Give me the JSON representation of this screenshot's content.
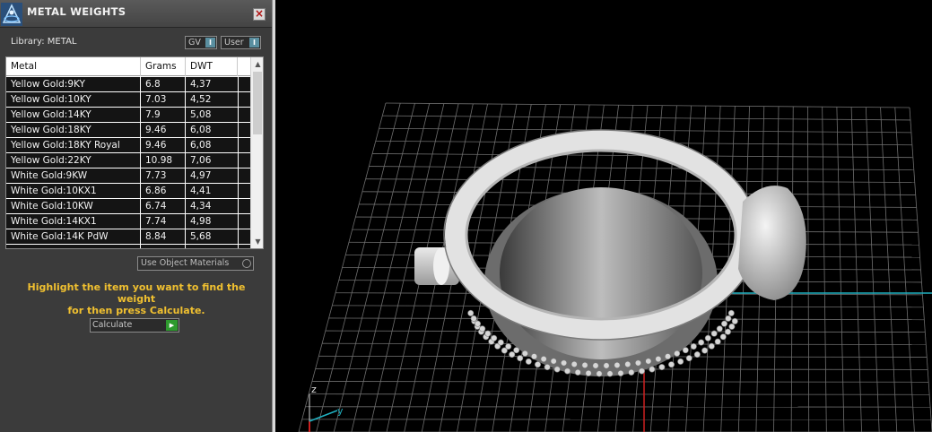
{
  "panel": {
    "title": "METAL WEIGHTS",
    "close_label": "×",
    "library_label": "Library: METAL",
    "gv_label": "GV",
    "user_label": "User",
    "indicator_label": "I"
  },
  "table": {
    "headers": {
      "metal": "Metal",
      "grams": "Grams",
      "dwt": "DWT"
    },
    "rows": [
      {
        "metal": "Yellow Gold:9KY",
        "grams": "6.8",
        "dwt": "4,37"
      },
      {
        "metal": "Yellow Gold:10KY",
        "grams": "7.03",
        "dwt": "4,52"
      },
      {
        "metal": "Yellow Gold:14KY",
        "grams": "7.9",
        "dwt": "5,08"
      },
      {
        "metal": "Yellow Gold:18KY",
        "grams": "9.46",
        "dwt": "6,08"
      },
      {
        "metal": "Yellow Gold:18KY Royal",
        "grams": "9.46",
        "dwt": "6,08"
      },
      {
        "metal": "Yellow Gold:22KY",
        "grams": "10.98",
        "dwt": "7,06"
      },
      {
        "metal": "White Gold:9KW",
        "grams": "7.73",
        "dwt": "4,97"
      },
      {
        "metal": "White Gold:10KX1",
        "grams": "6.86",
        "dwt": "4,41"
      },
      {
        "metal": "White Gold:10KW",
        "grams": "6.74",
        "dwt": "4,34"
      },
      {
        "metal": "White Gold:14KX1",
        "grams": "7.74",
        "dwt": "4,98"
      },
      {
        "metal": "White Gold:14K PdW",
        "grams": "8.84",
        "dwt": "5,68"
      }
    ],
    "scroll_up": "▲",
    "scroll_down": "▼"
  },
  "controls": {
    "use_object_materials": "Use Object Materials",
    "instructions_line1": "Highlight the item you want to find the weight",
    "instructions_line2": "for then press Calculate.",
    "calculate": "Calculate",
    "calculate_icon": "▶"
  },
  "viewport": {
    "axis_z": "z",
    "axis_y": "y",
    "colors": {
      "background": "#000000",
      "grid": "#6e6e6e",
      "axis_x": "#cc2020",
      "axis_y": "#20b0c0",
      "ring": "#d8d8d8"
    }
  },
  "icons": {
    "app_logo": "app-logo-icon",
    "close": "close-icon",
    "calculate": "play-arrow-icon"
  }
}
